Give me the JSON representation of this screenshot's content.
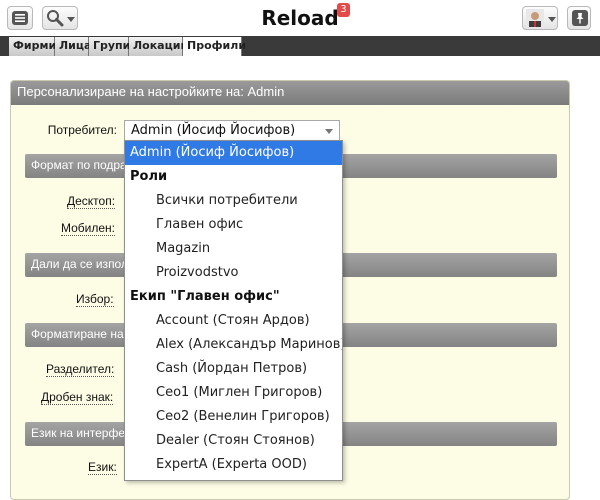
{
  "header": {
    "title": "Reload",
    "notification_count": "3",
    "menu_icon": "hamburger-icon",
    "search_icon": "magnifier-icon",
    "pin_icon": "pin-icon"
  },
  "tabs": [
    {
      "label": "Фирми",
      "active": false
    },
    {
      "label": "Лица",
      "active": false
    },
    {
      "label": "Групи",
      "active": false
    },
    {
      "label": "Локации",
      "active": false
    },
    {
      "label": "Профили",
      "active": true
    }
  ],
  "panel": {
    "title": "Персонализиране на настройките на: Admin",
    "user_label": "Потребител:",
    "user_value": "Admin (Йосиф Йосифов)",
    "sections": [
      {
        "title": "Формат по подра",
        "fields": [
          "Десктоп:",
          "Мобилен:"
        ]
      },
      {
        "title": "Дали да се изпол",
        "fields": [
          "Избор:"
        ]
      },
      {
        "title": "Форматиране на",
        "fields": [
          "Разделител:",
          "Дробен знак:"
        ]
      },
      {
        "title": "Език на интерфе",
        "fields": [
          "Език:"
        ]
      }
    ]
  },
  "dropdown": {
    "options": [
      {
        "label": "Admin (Йосиф Йосифов)",
        "kind": "selected"
      },
      {
        "label": "Роли",
        "kind": "group"
      },
      {
        "label": "Всички потребители",
        "kind": "item"
      },
      {
        "label": "Главен офис",
        "kind": "item"
      },
      {
        "label": "Magazin",
        "kind": "item"
      },
      {
        "label": "Proizvodstvo",
        "kind": "item"
      },
      {
        "label": "Екип \"Главен офис\"",
        "kind": "group"
      },
      {
        "label": "Account (Стоян Ардов)",
        "kind": "item"
      },
      {
        "label": "Alex (Александър Маринов)",
        "kind": "item"
      },
      {
        "label": "Cash (Йордан Петров)",
        "kind": "item"
      },
      {
        "label": "Ceo1 (Миглен Григоров)",
        "kind": "item"
      },
      {
        "label": "Ceo2 (Венелин Григоров)",
        "kind": "item"
      },
      {
        "label": "Dealer (Стоян Стоянов)",
        "kind": "item"
      },
      {
        "label": "ExpertA (Experta OOD)",
        "kind": "item"
      }
    ]
  },
  "colors": {
    "panel_background": "#fdfde6",
    "selected_option": "#2f7ae5",
    "badge": "#e34a4a",
    "tab_bar": "#3a3a3a"
  }
}
